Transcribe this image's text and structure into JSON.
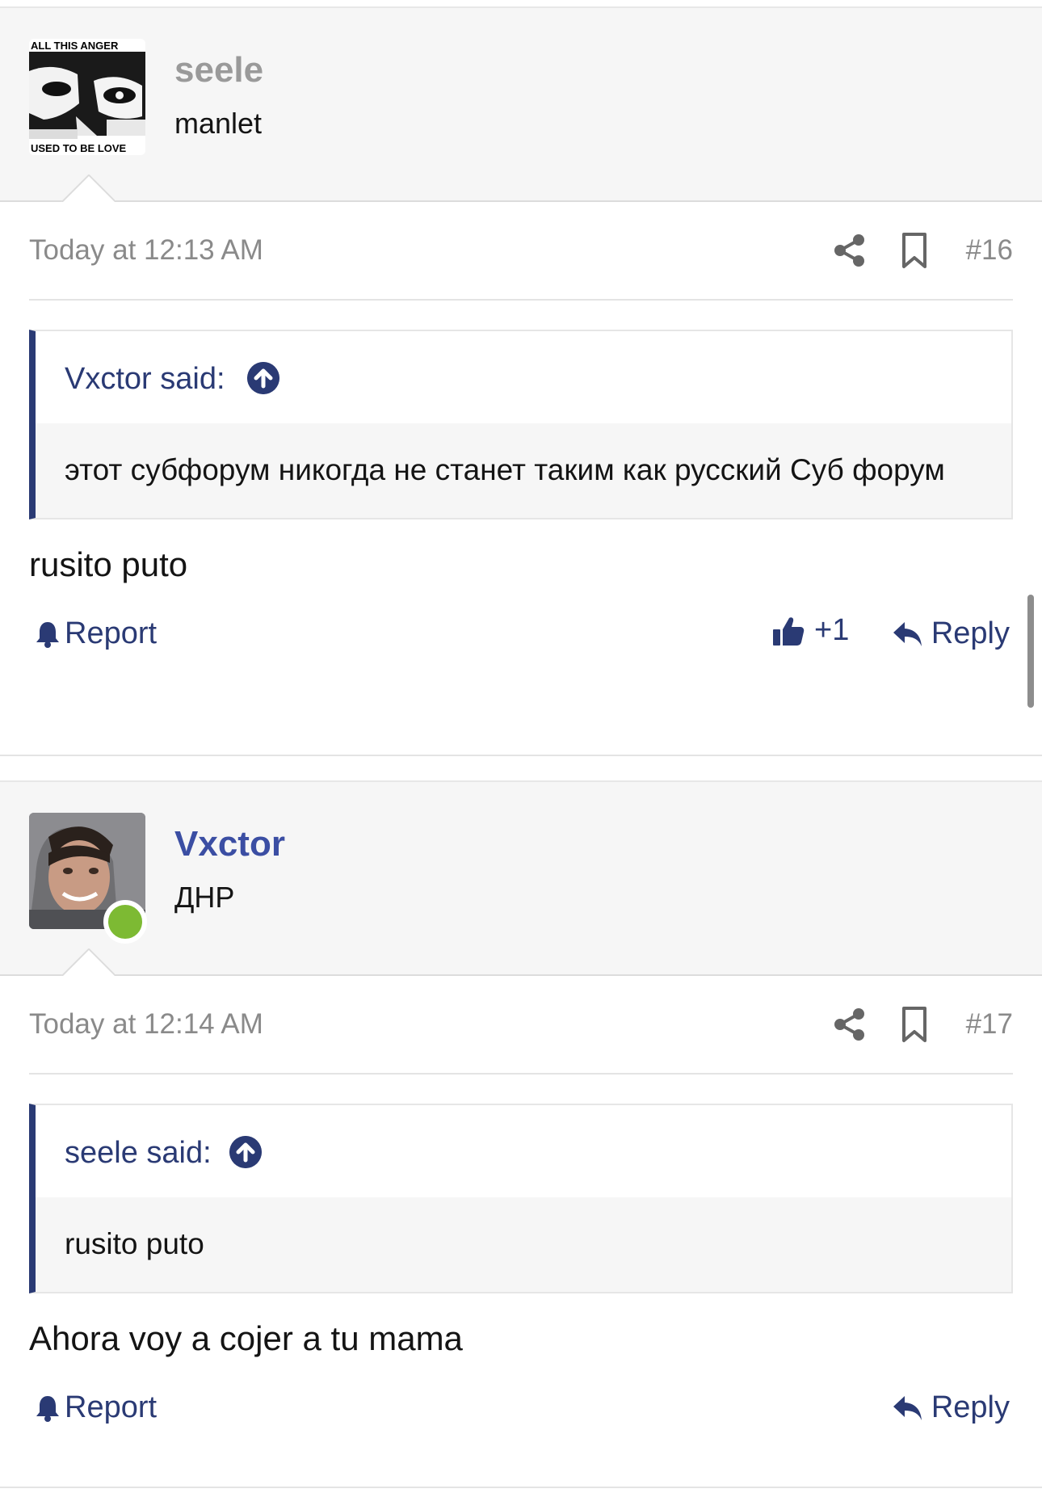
{
  "posts": [
    {
      "username": "seele",
      "user_title": "manlet",
      "avatar_caption_top": "ALL THIS ANGER",
      "avatar_caption_bottom": "USED TO BE LOVE",
      "date": "Today at 12:13 AM",
      "post_number": "#16",
      "quote": {
        "author": "Vxctor said:",
        "text": "этот субфорум никогда не станет таким как русский Суб форум"
      },
      "message": "rusito puto",
      "report_label": "Report",
      "like_count": "+1",
      "reply_label": "Reply"
    },
    {
      "username": "Vxctor",
      "user_title": "ДНР",
      "online": true,
      "date": "Today at 12:14 AM",
      "post_number": "#17",
      "quote": {
        "author": "seele said:",
        "text": "rusito puto"
      },
      "message": "Ahora voy a cojer a tu mama",
      "report_label": "Report",
      "reply_label": "Reply"
    }
  ],
  "colors": {
    "link": "#2a3a74",
    "username_active": "#3b4ea3",
    "username_muted": "#9a9a9a",
    "online": "#7dba33"
  },
  "icons": {
    "share": "share-icon",
    "bookmark": "bookmark-icon",
    "quote_up": "arrow-up-circle-icon",
    "report": "bell-icon",
    "like": "thumbs-up-icon",
    "reply": "reply-arrow-icon"
  }
}
